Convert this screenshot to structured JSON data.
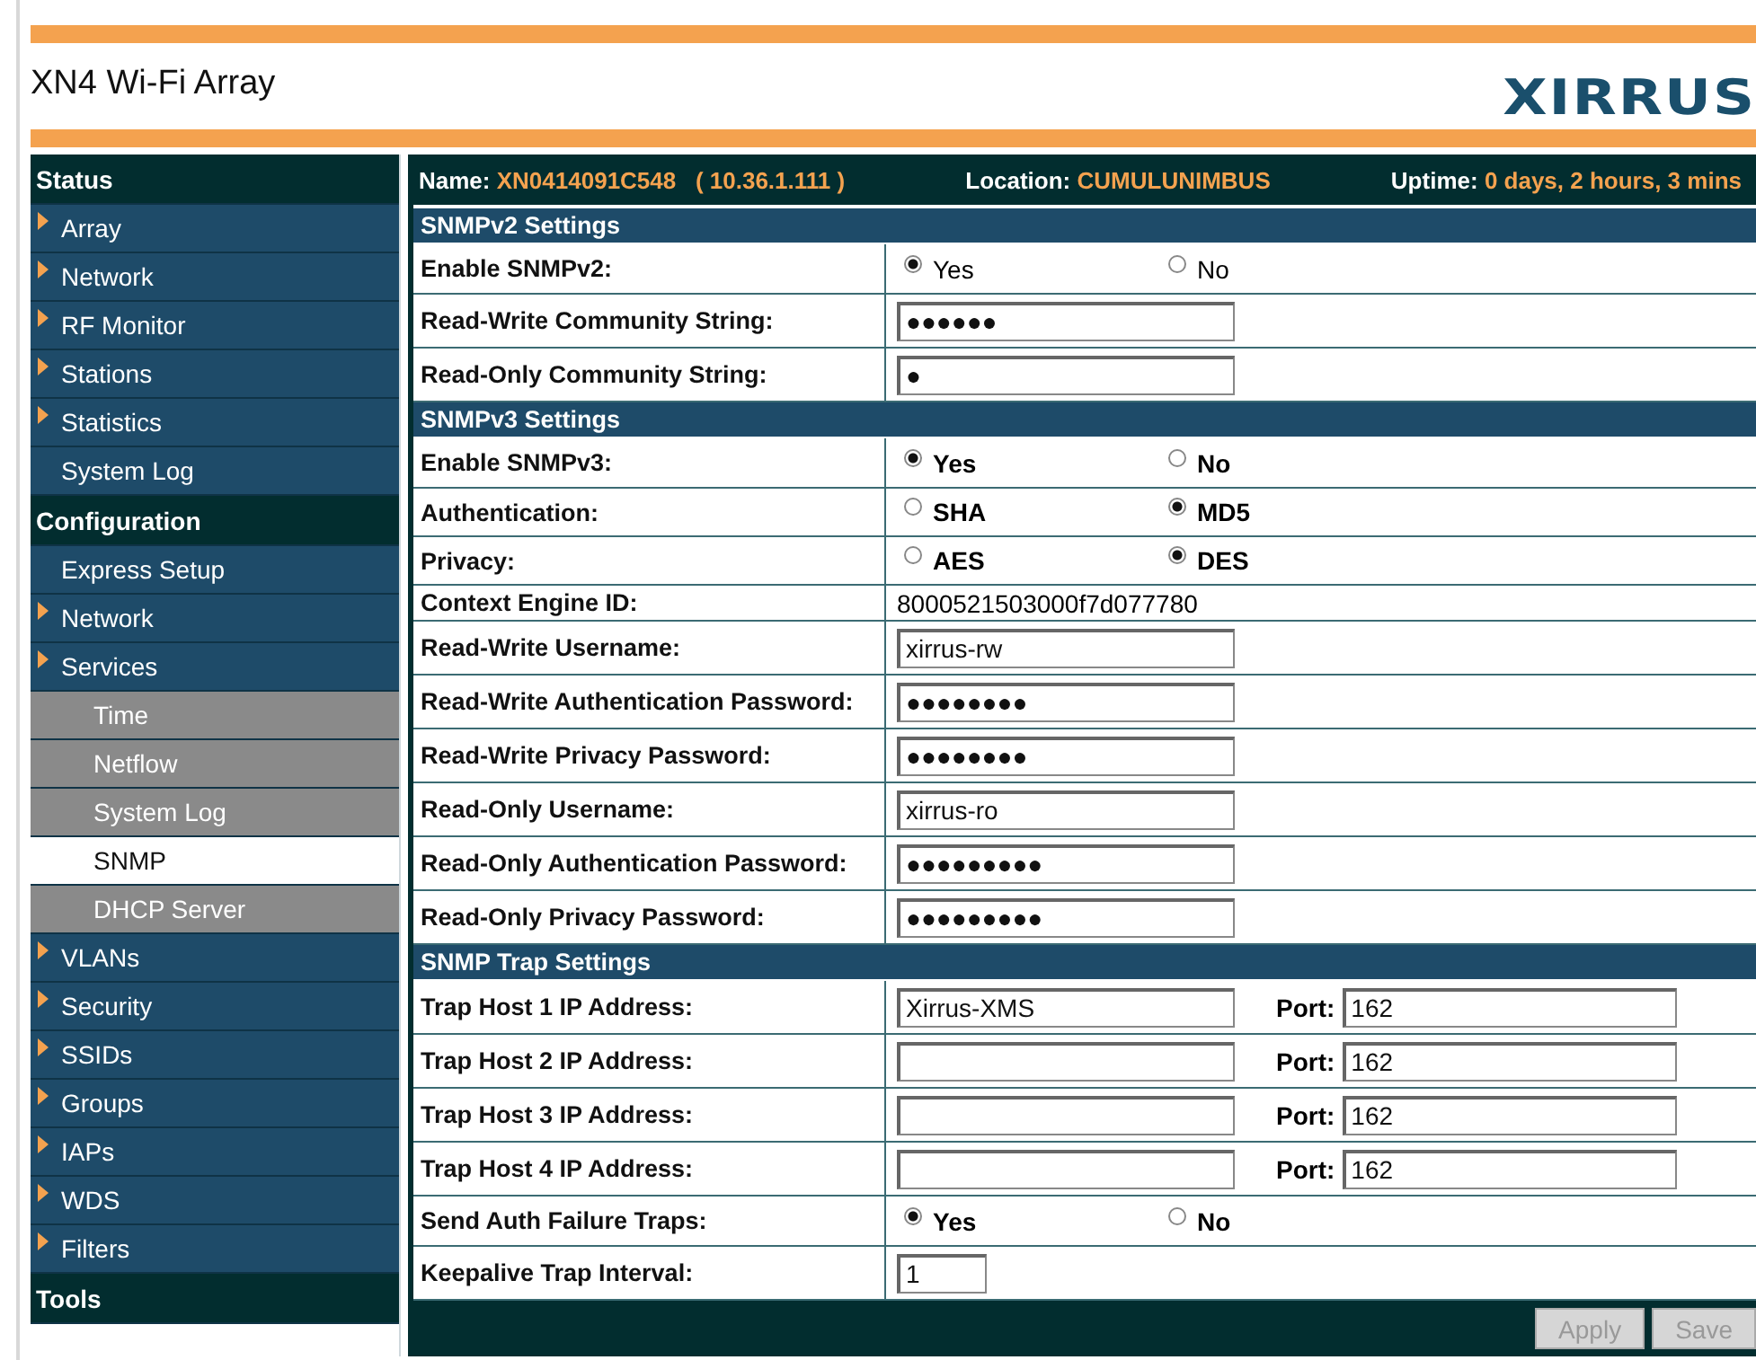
{
  "header": {
    "title": "XN4 Wi-Fi Array",
    "logo": "XIRRUS"
  },
  "sidebar": [
    {
      "kind": "heading",
      "label": "Status"
    },
    {
      "kind": "item",
      "label": "Array",
      "arrow": true
    },
    {
      "kind": "item",
      "label": "Network",
      "arrow": true
    },
    {
      "kind": "item",
      "label": "RF Monitor",
      "arrow": true
    },
    {
      "kind": "item",
      "label": "Stations",
      "arrow": true
    },
    {
      "kind": "item",
      "label": "Statistics",
      "arrow": true
    },
    {
      "kind": "item",
      "label": "System Log",
      "arrow": false
    },
    {
      "kind": "heading",
      "label": "Configuration"
    },
    {
      "kind": "item",
      "label": "Express Setup",
      "arrow": false
    },
    {
      "kind": "item",
      "label": "Network",
      "arrow": true
    },
    {
      "kind": "item",
      "label": "Services",
      "arrow": true
    },
    {
      "kind": "subitem",
      "label": "Time",
      "selected": false
    },
    {
      "kind": "subitem",
      "label": "Netflow",
      "selected": false
    },
    {
      "kind": "subitem",
      "label": "System Log",
      "selected": false
    },
    {
      "kind": "subitem",
      "label": "SNMP",
      "selected": true
    },
    {
      "kind": "subitem",
      "label": "DHCP Server",
      "selected": false
    },
    {
      "kind": "item",
      "label": "VLANs",
      "arrow": true
    },
    {
      "kind": "item",
      "label": "Security",
      "arrow": true
    },
    {
      "kind": "item",
      "label": "SSIDs",
      "arrow": true
    },
    {
      "kind": "item",
      "label": "Groups",
      "arrow": true
    },
    {
      "kind": "item",
      "label": "IAPs",
      "arrow": true
    },
    {
      "kind": "item",
      "label": "WDS",
      "arrow": true
    },
    {
      "kind": "item",
      "label": "Filters",
      "arrow": true
    },
    {
      "kind": "heading",
      "label": "Tools"
    }
  ],
  "info_bar": [
    {
      "label": "Name:",
      "value": "XN0414091C548   ( 10.36.1.111 )"
    },
    {
      "label": "Location:",
      "value": "CUMULUNIMBUS"
    },
    {
      "label": "Uptime:",
      "value": "0 days, 2 hours, 3 mins"
    }
  ],
  "sections": [
    {
      "title": "SNMPv2 Settings",
      "rows": [
        {
          "kind": "radio",
          "label": "Enable SNMPv2:",
          "bold_options": false,
          "options": [
            {
              "label": "Yes",
              "selected": true
            },
            {
              "label": "No",
              "selected": false
            }
          ]
        },
        {
          "kind": "input",
          "label": "Read-Write Community String:",
          "value": "●●●●●●"
        },
        {
          "kind": "input",
          "label": "Read-Only Community String:",
          "value": "●"
        }
      ]
    },
    {
      "title": "SNMPv3 Settings",
      "rows": [
        {
          "kind": "radio",
          "label": "Enable SNMPv3:",
          "bold_options": true,
          "options": [
            {
              "label": "Yes",
              "selected": true
            },
            {
              "label": "No",
              "selected": false
            }
          ]
        },
        {
          "kind": "radio",
          "label": "Authentication:",
          "bold_options": true,
          "options": [
            {
              "label": "SHA",
              "selected": false
            },
            {
              "label": "MD5",
              "selected": true
            }
          ]
        },
        {
          "kind": "radio",
          "label": "Privacy:",
          "bold_options": true,
          "options": [
            {
              "label": "AES",
              "selected": false
            },
            {
              "label": "DES",
              "selected": true
            }
          ]
        },
        {
          "kind": "static",
          "label": "Context Engine ID:",
          "value": "8000521503000f7d077780"
        },
        {
          "kind": "input",
          "label": "Read-Write Username:",
          "value": "xirrus-rw"
        },
        {
          "kind": "input",
          "label": "Read-Write Authentication Password:",
          "value": "●●●●●●●●"
        },
        {
          "kind": "input",
          "label": "Read-Write Privacy Password:",
          "value": "●●●●●●●●"
        },
        {
          "kind": "input",
          "label": "Read-Only Username:",
          "value": "xirrus-ro"
        },
        {
          "kind": "input",
          "label": "Read-Only Authentication Password:",
          "value": "●●●●●●●●●"
        },
        {
          "kind": "input",
          "label": "Read-Only Privacy Password:",
          "value": "●●●●●●●●●"
        }
      ]
    },
    {
      "title": "SNMP Trap Settings",
      "rows": [
        {
          "kind": "trap",
          "label": "Trap Host 1 IP Address:",
          "value": "Xirrus-XMS",
          "port_label": "Port:",
          "port": "162"
        },
        {
          "kind": "trap",
          "label": "Trap Host 2 IP Address:",
          "port_label": "Port:",
          "port": "162"
        },
        {
          "kind": "trap",
          "label": "Trap Host 3 IP Address:",
          "port_label": "Port:",
          "port": "162"
        },
        {
          "kind": "trap",
          "label": "Trap Host 4 IP Address:",
          "port_label": "Port:",
          "port": "162"
        },
        {
          "kind": "radio",
          "label": "Send Auth Failure Traps:",
          "bold_options": true,
          "options": [
            {
              "label": "Yes",
              "selected": true
            },
            {
              "label": "No",
              "selected": false
            }
          ]
        },
        {
          "kind": "short",
          "label": "Keepalive Trap Interval:",
          "value": "1"
        }
      ]
    }
  ],
  "buttons": [
    {
      "label": "Apply",
      "disabled": true
    },
    {
      "label": "Save",
      "disabled": true
    }
  ]
}
